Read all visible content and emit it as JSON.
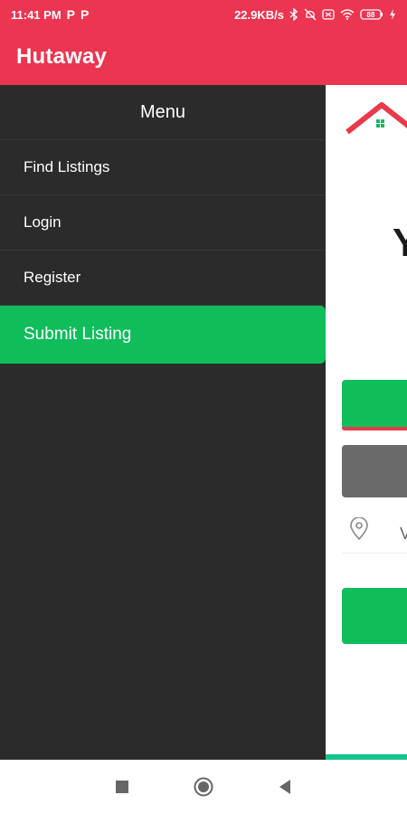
{
  "status_bar": {
    "time": "11:41 PM",
    "p_icons": [
      "P",
      "P"
    ],
    "network_speed": "22.9KB/s",
    "battery": "88"
  },
  "app_bar": {
    "title": "Hutaway"
  },
  "drawer": {
    "header": "Menu",
    "items": [
      {
        "label": "Find Listings"
      },
      {
        "label": "Login"
      },
      {
        "label": "Register"
      },
      {
        "label": "Submit Listing",
        "active": true
      }
    ]
  },
  "page": {
    "partial_heading_letter": "Y",
    "partial_location_letter": "V"
  },
  "colors": {
    "header": "#ec3551",
    "drawer": "#2b2b2b",
    "accent_green": "#0fbd5b"
  },
  "nav_bar": {
    "icons": [
      "square-icon",
      "circle-icon",
      "back-triangle-icon"
    ]
  }
}
